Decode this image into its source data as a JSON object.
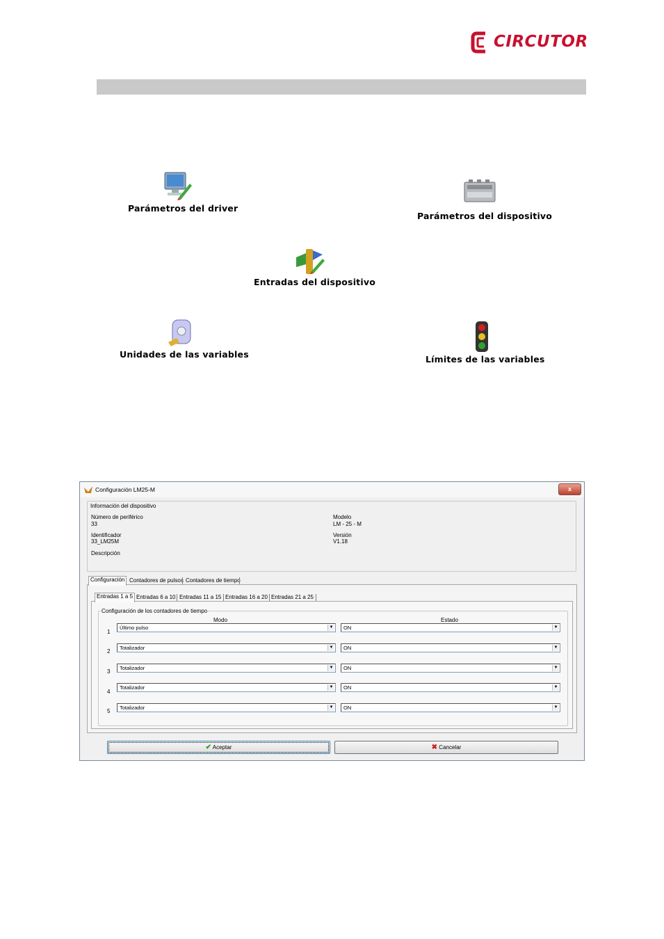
{
  "header": {
    "brand": "CIRCUTOR"
  },
  "desktop_icons": [
    {
      "label": "Parámetros del driver",
      "icon": "computer-pencil-icon"
    },
    {
      "label": "Parámetros del dispositivo",
      "icon": "device-module-icon"
    },
    {
      "label": "Entradas del dispositivo",
      "icon": "inputs-pencil-icon"
    },
    {
      "label": "Unidades de las variables",
      "icon": "units-cylinder-icon"
    },
    {
      "label": "Límites de las variables",
      "icon": "traffic-light-icon"
    }
  ],
  "dialog": {
    "title": "Configuración LM25-M",
    "close_label": "x",
    "info": {
      "legend": "Información del dispositivo",
      "peripheral_label": "Número de periférico",
      "peripheral_value": "33",
      "identifier_label": "Identificador",
      "identifier_value": "33_LM25M",
      "description_label": "Descripción",
      "model_label": "Modelo",
      "model_value": "LM - 25 - M",
      "version_label": "Versión",
      "version_value": "V1.18"
    },
    "tabs": [
      "Configuración",
      "Contadores de pulsos",
      "Contadores de tiempo"
    ],
    "subtabs": [
      "Entradas 1 a 5",
      "Entradas 6 a 10",
      "Entradas 11 a 15",
      "Entradas 16 a 20",
      "Entradas 21 a 25"
    ],
    "group_title": "Configuración de los contadores de tiempo",
    "col_mode": "Modo",
    "col_state": "Estado",
    "rows": [
      {
        "n": "1",
        "mode": "Último pulso",
        "state": "ON"
      },
      {
        "n": "2",
        "mode": "Totalizador",
        "state": "ON"
      },
      {
        "n": "3",
        "mode": "Totalizador",
        "state": "ON"
      },
      {
        "n": "4",
        "mode": "Totalizador",
        "state": "ON"
      },
      {
        "n": "5",
        "mode": "Totalizador",
        "state": "ON"
      }
    ],
    "accept_label": "Aceptar",
    "cancel_label": "Cancelar",
    "colors": {
      "accent": "#c8102e",
      "ok": "#2e9a2e",
      "cancel": "#d02020"
    }
  }
}
